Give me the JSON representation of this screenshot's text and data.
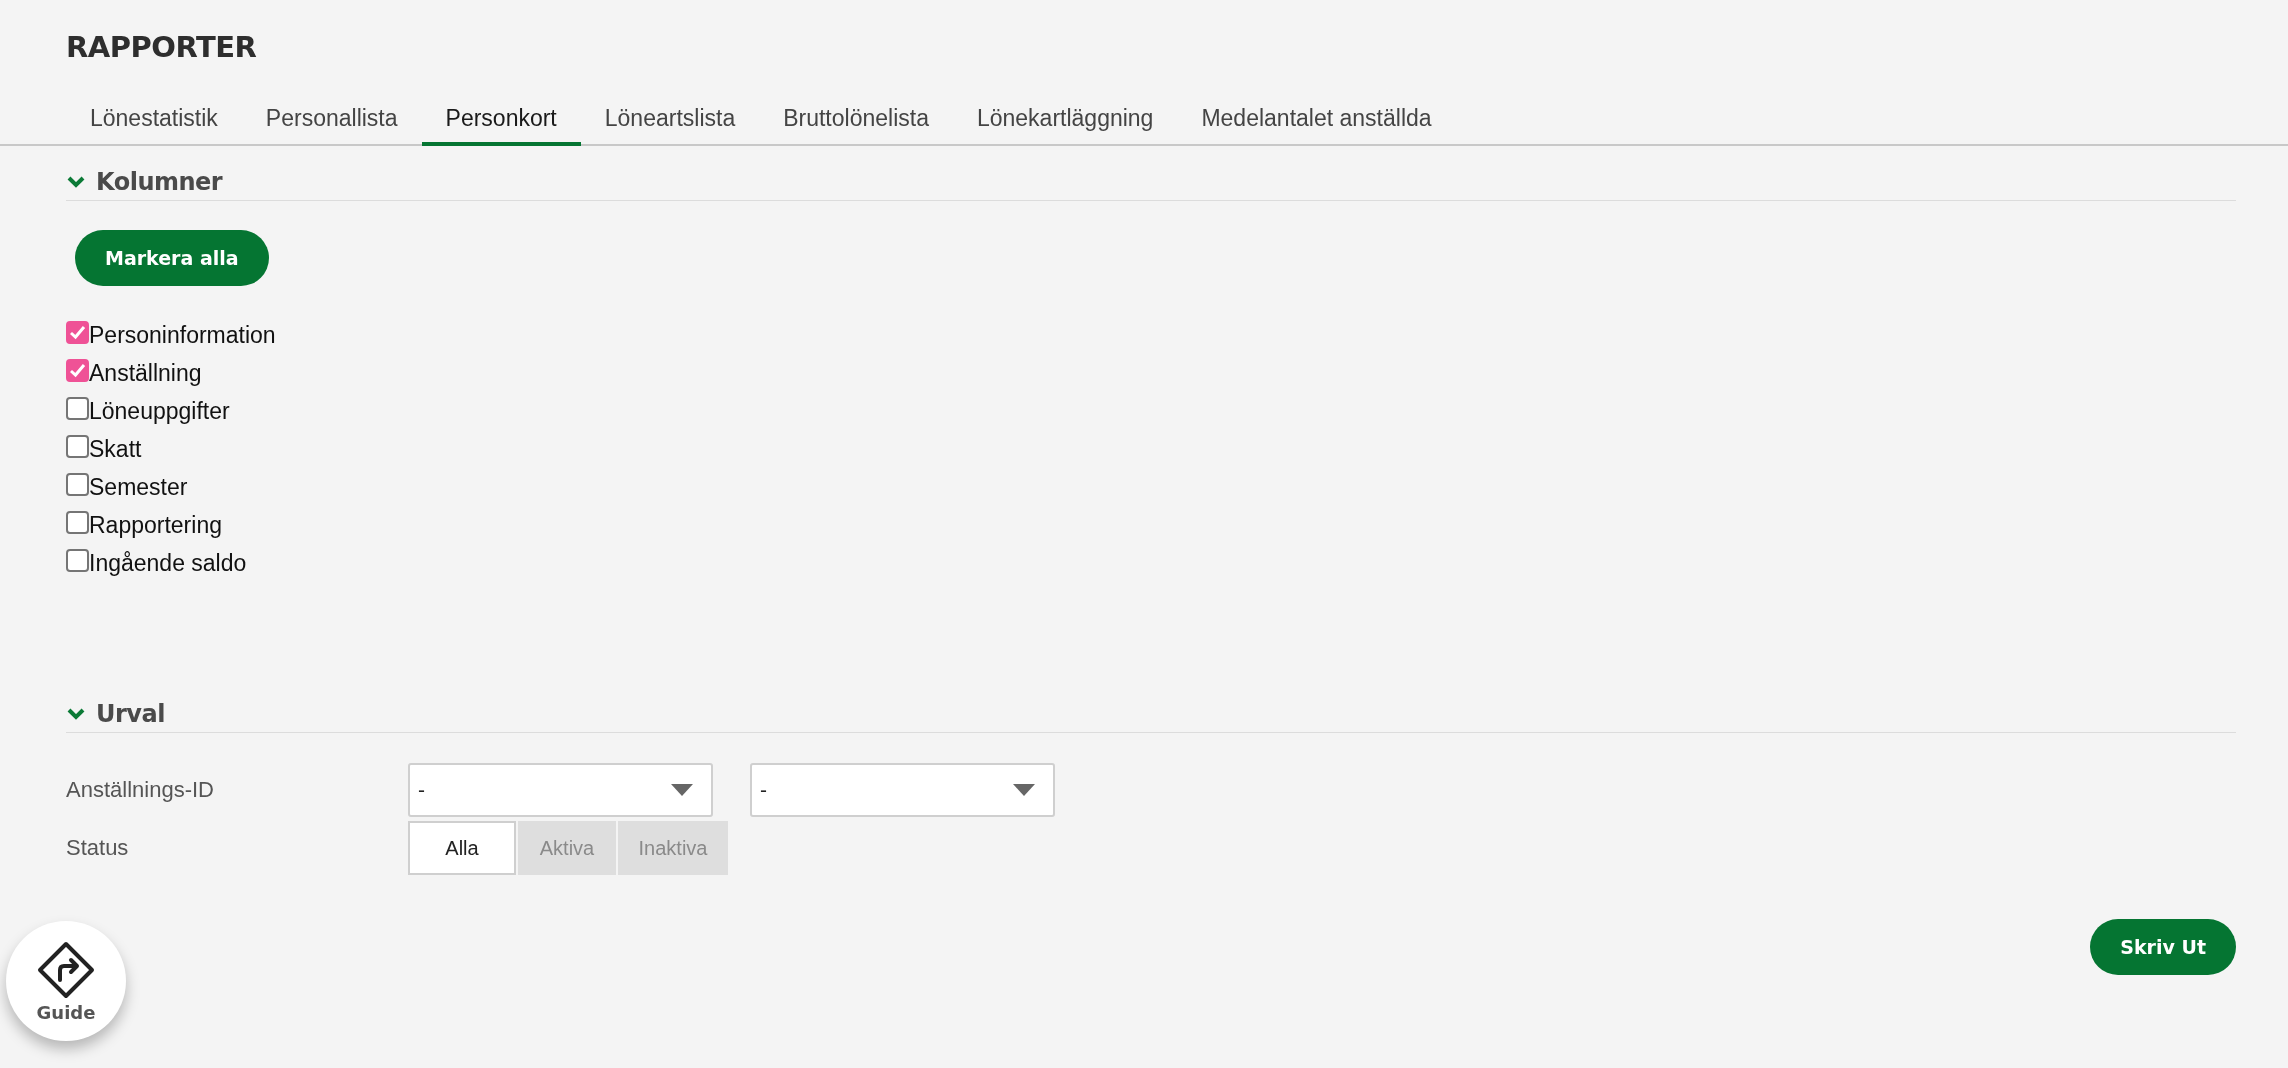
{
  "title": "RAPPORTER",
  "tabs": [
    {
      "label": "Lönestatistik",
      "selected": false
    },
    {
      "label": "Personallista",
      "selected": false
    },
    {
      "label": "Personkort",
      "selected": true
    },
    {
      "label": "Löneartslista",
      "selected": false
    },
    {
      "label": "Bruttolönelista",
      "selected": false
    },
    {
      "label": "Lönekartläggning",
      "selected": false
    },
    {
      "label": "Medelantalet anställda",
      "selected": false
    }
  ],
  "kolumner": {
    "heading": "Kolumner",
    "expanded": true,
    "select_all_button": "Markera alla",
    "options": [
      {
        "label": "Personinformation",
        "checked": true
      },
      {
        "label": "Anställning",
        "checked": true
      },
      {
        "label": "Löneuppgifter",
        "checked": false
      },
      {
        "label": "Skatt",
        "checked": false
      },
      {
        "label": "Semester",
        "checked": false
      },
      {
        "label": "Rapportering",
        "checked": false
      },
      {
        "label": "Ingående saldo",
        "checked": false
      }
    ]
  },
  "urval": {
    "heading": "Urval",
    "expanded": true,
    "employment_id": {
      "label": "Anställnings-ID",
      "from_value": "-",
      "to_value": "-"
    },
    "status": {
      "label": "Status",
      "options": [
        {
          "label": "Alla",
          "selected": true
        },
        {
          "label": "Aktiva",
          "selected": false
        },
        {
          "label": "Inaktiva",
          "selected": false
        }
      ]
    }
  },
  "guide_button": "Guide",
  "print_button": "Skriv Ut"
}
